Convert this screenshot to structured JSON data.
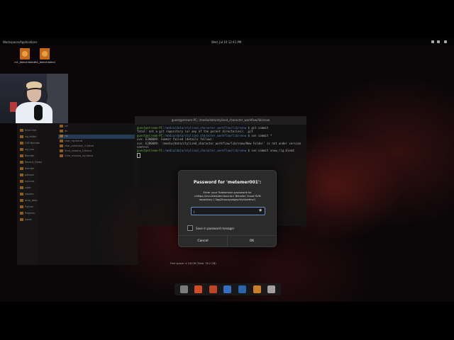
{
  "topbar": {
    "workspaces": "Workspaces",
    "applications": "Applications",
    "datetime": "Wed, Jul 10  12:41 PM"
  },
  "desktop_icons": [
    {
      "label": "m1_blendr.blend"
    },
    {
      "label": "m1_blendr.blend"
    }
  ],
  "file_manager": {
    "items": [
      "Shot One",
      "rig_folder",
      "CSS Blender",
      "rig_hair",
      "Blender",
      "Recent_Folder",
      "blender",
      "poliqon",
      "sources",
      "code",
      "reports",
      "drop_data",
      "Python",
      "Projects",
      "notes"
    ],
    "files": [
      "ref",
      "ds",
      "rig",
      "char_rig.blend",
      "char_collection_2.blend",
      "Shot_camera_0.blend",
      "Char_module_rig.blend"
    ]
  },
  "terminal": {
    "title": "guest@stream-PC: /media/data/stylized_character_workflow/lib/snow",
    "lines": [
      {
        "user": "guest@stream-PC",
        "path": ":/media/data/stylized_character_workflow/lib/snow",
        "cmd": "$ git commit"
      },
      {
        "user": "",
        "path": "",
        "cmd": "fatal: not a git repository (or any of the parent directories): .git"
      },
      {
        "user": "guest@stream-PC",
        "path": ":/media/data/stylized_character_workflow/lib/snow",
        "cmd": "$ svn commit *"
      },
      {
        "user": "",
        "path": "",
        "cmd": "svn: E200009: Commit failed (details follow):"
      },
      {
        "user": "",
        "path": "",
        "cmd": "svn: E200009: '/media/data/stylized_character_workflow/lib/snow/New Folder' is not under version control"
      },
      {
        "user": "guest@stream-PC",
        "path": ":/media/data/stylized_character_workflow/lib/snow",
        "cmd": "$ svn commit snow_rig.blend"
      }
    ]
  },
  "status_text": "Free space: 4.1/8 GB (Total: 76.2 GB)",
  "dialog": {
    "title": "Password for 'metemer001':",
    "message": "Enter your Subversion password for <https://svn.blendercloud.io> Blender Cloud SVN repository ('4qg2houayxdgeyhfyt4xefmz')",
    "password_value": "|",
    "save_label": "Save in password manager",
    "cancel_label": "Cancel",
    "ok_label": "OK"
  },
  "dock": {
    "items": [
      "files-icon",
      "firefox-icon",
      "terminal-icon",
      "vscode-icon",
      "blender-icon",
      "settings-icon",
      "screenshot-icon"
    ],
    "colors": [
      "#888888",
      "#e8532a",
      "#d44a2a",
      "#3a7bd5",
      "#2d6fbf",
      "#e08a2a",
      "#b0b0b0"
    ]
  },
  "colors": {
    "accent": "#6a8cc8",
    "dialog_bg": "#2b2b2b"
  }
}
